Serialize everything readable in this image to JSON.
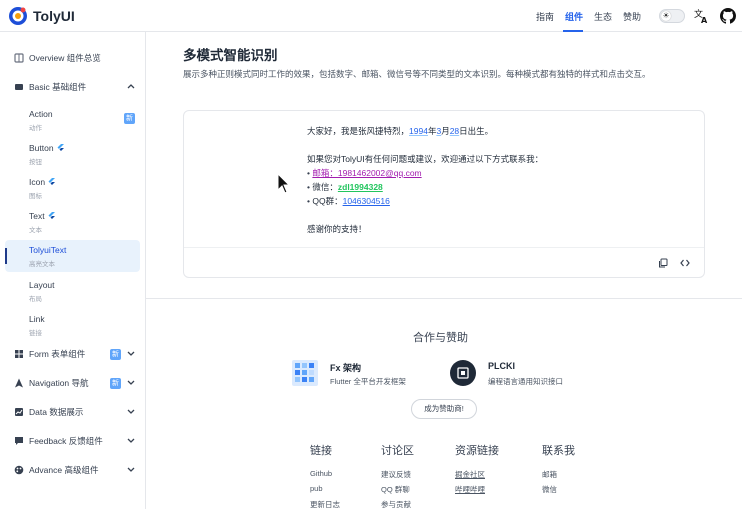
{
  "header": {
    "brand": "TolyUI",
    "nav": [
      "指南",
      "组件",
      "生态",
      "赞助"
    ],
    "theme_icon": "sun-icon",
    "colors": {
      "accent": "#2563eb"
    }
  },
  "sidebar": {
    "items": [
      {
        "label": "Overview 组件总览",
        "icon": "book-icon"
      },
      {
        "label": "Basic 基础组件",
        "icon": "layers-icon"
      },
      {
        "label": "Form 表单组件",
        "icon": "grid-icon",
        "badge": "新"
      },
      {
        "label": "Navigation 导航",
        "icon": "navigation-icon",
        "badge": "新"
      },
      {
        "label": "Data 数据展示",
        "icon": "chart-icon"
      },
      {
        "label": "Feedback 反馈组件",
        "icon": "message-icon"
      },
      {
        "label": "Advance 高级组件",
        "icon": "palette-icon"
      }
    ],
    "basic_children": [
      {
        "title": "Action",
        "desc": "动作",
        "badge": "新"
      },
      {
        "title": "Button",
        "desc": "按钮"
      },
      {
        "title": "Icon",
        "desc": "图标"
      },
      {
        "title": "Text",
        "desc": "文本"
      },
      {
        "title": "TolyuiText",
        "desc": "高亮文本"
      },
      {
        "title": "Layout",
        "desc": "布局"
      },
      {
        "title": "Link",
        "desc": "链接"
      }
    ]
  },
  "main": {
    "title": "多模式智能识别",
    "description": "展示多种正则模式同时工作的效果，包括数字、邮箱、微信号等不同类型的文本识别。每种模式都有独特的样式和点击交互。",
    "demo": {
      "line1_pre": "大家好，我是张风捷特烈，",
      "year": "1994",
      "year_suffix": "年",
      "month": "3",
      "month_suffix": "月",
      "day": "28",
      "day_suffix": "日出生。",
      "line2": "如果您对TolyUI有任何问题或建议，欢迎通过以下方式联系我：",
      "bullet": "•",
      "email": "邮箱：1981462002@qq.com",
      "wechat_label": "微信：",
      "wechat": "zdl1994328",
      "qq_label": "QQ群：",
      "qq": "1046304516",
      "thanks": "感谢你的支持！"
    }
  },
  "sponsors": {
    "title": "合作与赞助",
    "items": [
      {
        "name": "Fx 架构",
        "desc": "Flutter 全平台开发框架"
      },
      {
        "name": "PLCKI",
        "desc": "编程语言通用知识接口"
      }
    ],
    "button": "成为赞助商!"
  },
  "footer": {
    "columns": [
      {
        "heading": "链接",
        "links": [
          "Github",
          "pub",
          "更新日志"
        ]
      },
      {
        "heading": "讨论区",
        "links": [
          "建议反馈",
          "QQ 群聊",
          "参与贡献"
        ]
      },
      {
        "heading": "资源链接",
        "links": [
          "掘金社区",
          "哔哩哔哩"
        ]
      },
      {
        "heading": "联系我",
        "links": [
          "邮箱",
          "微信"
        ]
      }
    ]
  }
}
